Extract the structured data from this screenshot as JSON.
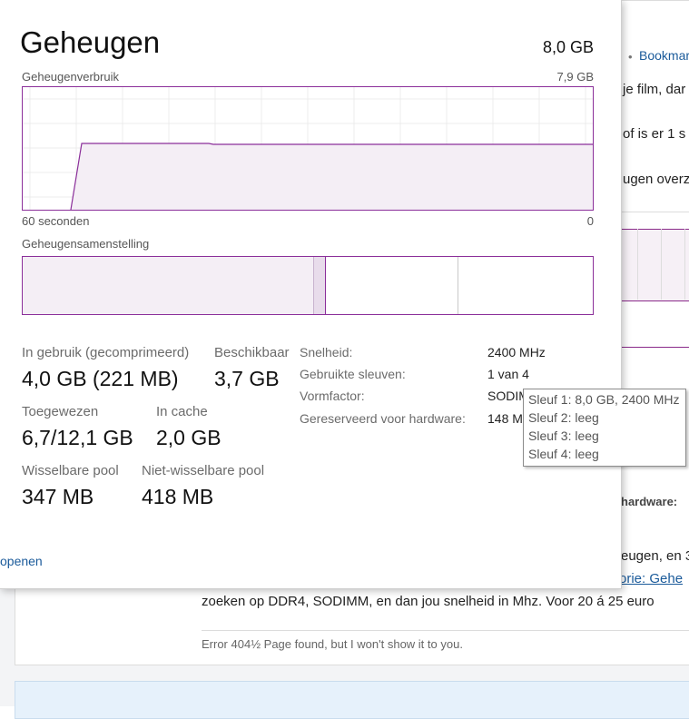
{
  "background": {
    "bookmark_link": "Bookmar",
    "bullet": "•",
    "lines": [
      "je film, dar",
      "of is er 1 s",
      "ugen overz"
    ],
    "hardware_label": "hardware:",
    "cut_line_1_text": "eugen, en 3",
    "cut_line_2_link": "orie: Gehe",
    "body_line": "zoeken op DDR4, SODIMM, en dan jou snelheid in Mhz. Voor 20 á 25 euro",
    "signature": "Error 404½ Page found, but I won't show it to you.",
    "cut_char_right": "H"
  },
  "memory": {
    "title": "Geheugen",
    "total": "8,0 GB",
    "usage_label": "Geheugenverbruik",
    "usage_max": "7,9 GB",
    "time_left": "60 seconden",
    "time_right": "0",
    "composition_label": "Geheugensamenstelling",
    "stats": {
      "in_use_label": "In gebruik (gecomprimeerd)",
      "in_use_value": "4,0 GB (221 MB)",
      "available_label": "Beschikbaar",
      "available_value": "3,7 GB",
      "committed_label": "Toegewezen",
      "committed_value": "6,7/12,1 GB",
      "cached_label": "In cache",
      "cached_value": "2,0 GB",
      "paged_label": "Wisselbare pool",
      "paged_value": "347 MB",
      "nonpaged_label": "Niet-wisselbare pool",
      "nonpaged_value": "418 MB"
    },
    "details": {
      "speed_label": "Snelheid:",
      "speed_value": "2400 MHz",
      "slots_label": "Gebruikte sleuven:",
      "slots_value": "1 van 4",
      "form_label": "Vormfactor:",
      "form_value": "SODIM",
      "reserved_label": "Gereserveerd voor hardware:",
      "reserved_value": "148 M"
    },
    "open_link": "openen"
  },
  "tooltip": {
    "lines": [
      "Sleuf 1: 8,0 GB, 2400 MHz",
      "Sleuf 2: leeg",
      "Sleuf 3: leeg",
      "Sleuf 4: leeg"
    ]
  },
  "colors": {
    "accent": "#8b2f9a",
    "graph_fill": "#f4eef5",
    "link": "#1a5a9a"
  }
}
